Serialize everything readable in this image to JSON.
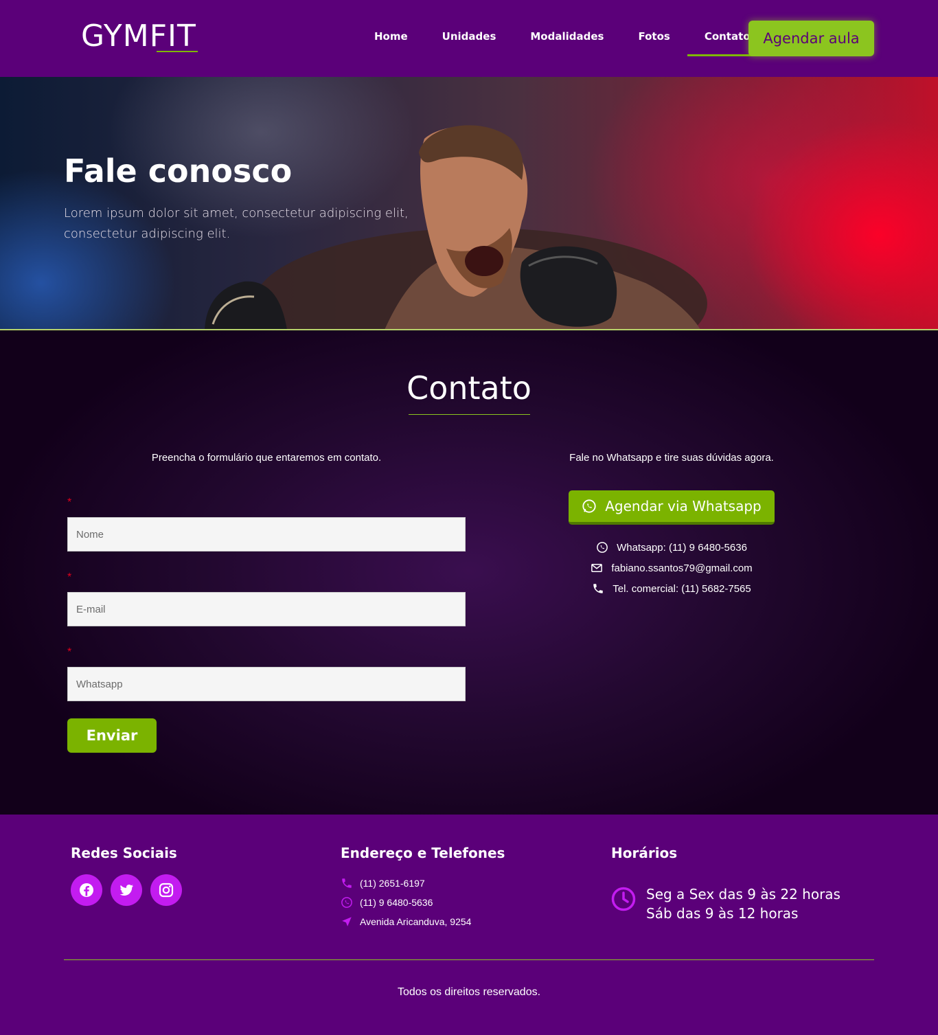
{
  "header": {
    "logo": "GYMFIT",
    "nav": [
      "Home",
      "Unidades",
      "Modalidades",
      "Fotos",
      "Contato"
    ],
    "active_nav": "Contato",
    "cta_label": "Agendar aula",
    "accent_color": "#8cc51f",
    "bg_color": "#5b0079"
  },
  "hero": {
    "title": "Fale conosco",
    "text": "Lorem ipsum dolor sit amet, consectetur adipiscing elit, consectetur adipiscing elit."
  },
  "contact": {
    "title": "Contato",
    "form_intro": "Preencha o formulário que entaremos em contato.",
    "required_mark": "*",
    "fields": {
      "name_placeholder": "Nome",
      "email_placeholder": "E-mail",
      "whatsapp_placeholder": "Whatsapp"
    },
    "submit_label": "Enviar",
    "wa_intro": "Fale no Whatsapp e tire suas dúvidas agora.",
    "wa_button": "Agendar via Whatsapp",
    "details": {
      "whatsapp": "Whatsapp: (11) 9 6480-5636",
      "email": "fabiano.ssantos79@gmail.com",
      "phone": "Tel. comercial: (11) 5682-7565"
    }
  },
  "footer": {
    "social_title": "Redes Sociais",
    "social_icons": [
      "facebook-icon",
      "twitter-icon",
      "instagram-icon"
    ],
    "address_title": "Endereço e Telefones",
    "phone": "(11) 2651-6197",
    "whatsapp": "(11) 9 6480-5636",
    "address": "Avenida Aricanduva, 9254",
    "hours_title": "Horários",
    "hours_weekdays": "Seg a Sex das 9 às 22 horas",
    "hours_saturday": "Sáb das 9 às 12 horas",
    "copyright": "Todos os direitos reservados.",
    "icon_color": "#c31cf0"
  }
}
